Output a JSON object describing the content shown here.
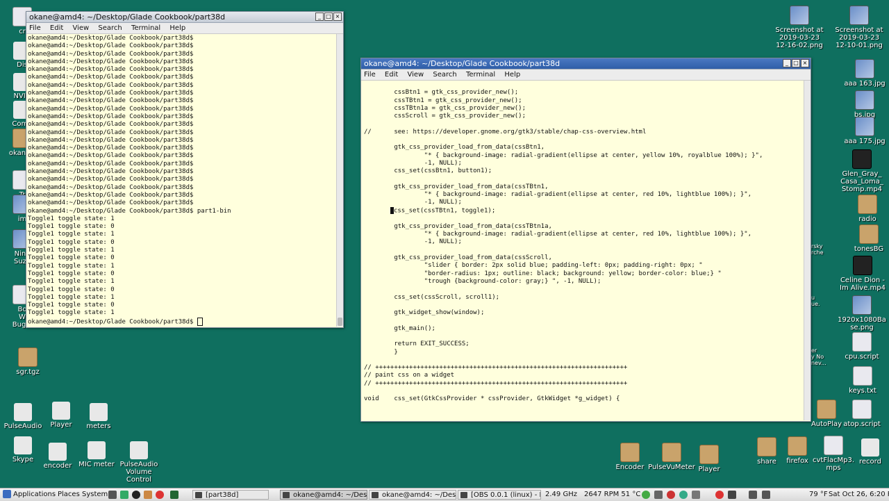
{
  "desktop_left": [
    {
      "id": "cr",
      "label": "cr"
    },
    {
      "id": "dis",
      "label": "Dis"
    },
    {
      "id": "nvid",
      "label": "NVID"
    },
    {
      "id": "comp",
      "label": "Comp"
    },
    {
      "id": "okanes",
      "label": "okane's"
    },
    {
      "id": "tr",
      "label": "Tr"
    },
    {
      "id": "im",
      "label": "im"
    },
    {
      "id": "nina",
      "label": "Nina\nSuza"
    },
    {
      "id": "bo",
      "label": "Bo\nW\nBugle"
    },
    {
      "id": "sgr",
      "label": "sgr.tgz"
    },
    {
      "id": "pulseaudio",
      "label": "PulseAudio"
    },
    {
      "id": "player",
      "label": "Player"
    },
    {
      "id": "meters",
      "label": "meters"
    },
    {
      "id": "skype",
      "label": "Skype"
    },
    {
      "id": "encoder",
      "label": "encoder"
    },
    {
      "id": "micmeter",
      "label": "MIC meter"
    },
    {
      "id": "pavc",
      "label": "PulseAudio\nVolume\nControl"
    }
  ],
  "desktop_right": [
    {
      "id": "ss1",
      "label": "Screenshot at\n2019-03-23\n12-16-02.png"
    },
    {
      "id": "ss2",
      "label": "Screenshot at\n2019-03-23\n12-10-01.png"
    },
    {
      "id": "aaa163",
      "label": "aaa 163.jpg"
    },
    {
      "id": "bs",
      "label": "bs.jpg"
    },
    {
      "id": "aaa175",
      "label": "aaa 175.jpg"
    },
    {
      "id": "glen",
      "label": "Glen_Gray_\nCasa_Loma_\nStomp.mp4"
    },
    {
      "id": "radio",
      "label": "radio"
    },
    {
      "id": "tonesbg",
      "label": "tonesBG"
    },
    {
      "id": "celine",
      "label": "Celine Dion -\nIm Alive.mp4"
    },
    {
      "id": "png1920",
      "label": "1920x1080Ba\nse.png"
    },
    {
      "id": "cpuscript",
      "label": "cpu.script"
    },
    {
      "id": "keys",
      "label": "keys.txt"
    },
    {
      "id": "autoplay",
      "label": "AutoPlay"
    },
    {
      "id": "atop",
      "label": "atop.script"
    },
    {
      "id": "encoder2",
      "label": "Encoder"
    },
    {
      "id": "pvm",
      "label": "PulseVuMeter"
    },
    {
      "id": "player2",
      "label": "Player"
    },
    {
      "id": "share",
      "label": "share"
    },
    {
      "id": "firefox",
      "label": "firefox"
    },
    {
      "id": "cvt",
      "label": "cvtFlacMp3.\nmps"
    },
    {
      "id": "record",
      "label": "record"
    }
  ],
  "snippets": [
    "rsky\nrche",
    "u\nue.",
    "er\ny No\nnev..."
  ],
  "left_window": {
    "title": "okane@amd4: ~/Desktop/Glade Cookbook/part38d",
    "menu": [
      "File",
      "Edit",
      "View",
      "Search",
      "Terminal",
      "Help"
    ],
    "lines": [
      "okane@amd4:~/Desktop/Glade Cookbook/part38d$",
      "okane@amd4:~/Desktop/Glade Cookbook/part38d$",
      "okane@amd4:~/Desktop/Glade Cookbook/part38d$",
      "okane@amd4:~/Desktop/Glade Cookbook/part38d$",
      "okane@amd4:~/Desktop/Glade Cookbook/part38d$",
      "okane@amd4:~/Desktop/Glade Cookbook/part38d$",
      "okane@amd4:~/Desktop/Glade Cookbook/part38d$",
      "okane@amd4:~/Desktop/Glade Cookbook/part38d$",
      "okane@amd4:~/Desktop/Glade Cookbook/part38d$",
      "okane@amd4:~/Desktop/Glade Cookbook/part38d$",
      "okane@amd4:~/Desktop/Glade Cookbook/part38d$",
      "okane@amd4:~/Desktop/Glade Cookbook/part38d$",
      "okane@amd4:~/Desktop/Glade Cookbook/part38d$",
      "okane@amd4:~/Desktop/Glade Cookbook/part38d$",
      "okane@amd4:~/Desktop/Glade Cookbook/part38d$",
      "okane@amd4:~/Desktop/Glade Cookbook/part38d$",
      "okane@amd4:~/Desktop/Glade Cookbook/part38d$",
      "okane@amd4:~/Desktop/Glade Cookbook/part38d$",
      "okane@amd4:~/Desktop/Glade Cookbook/part38d$",
      "okane@amd4:~/Desktop/Glade Cookbook/part38d$",
      "okane@amd4:~/Desktop/Glade Cookbook/part38d$",
      "okane@amd4:~/Desktop/Glade Cookbook/part38d$",
      "okane@amd4:~/Desktop/Glade Cookbook/part38d$ part1-bin",
      "Toggle1 toggle state: 1",
      "Toggle1 toggle state: 0",
      "Toggle1 toggle state: 1",
      "Toggle1 toggle state: 0",
      "Toggle1 toggle state: 1",
      "Toggle1 toggle state: 0",
      "Toggle1 toggle state: 1",
      "Toggle1 toggle state: 0",
      "Toggle1 toggle state: 1",
      "Toggle1 toggle state: 0",
      "Toggle1 toggle state: 1",
      "Toggle1 toggle state: 0",
      "Toggle1 toggle state: 1"
    ],
    "prompt": "okane@amd4:~/Desktop/Glade Cookbook/part38d$ "
  },
  "right_window": {
    "title": "okane@amd4: ~/Desktop/Glade Cookbook/part38d",
    "menu": [
      "File",
      "Edit",
      "View",
      "Search",
      "Terminal",
      "Help"
    ],
    "lines": [
      "",
      "        cssBtn1 = gtk_css_provider_new();",
      "        cssTBtn1 = gtk_css_provider_new();",
      "        cssTBtn1a = gtk_css_provider_new();",
      "        cssScroll = gtk_css_provider_new();",
      "",
      "//      see: https://developer.gnome.org/gtk3/stable/chap-css-overview.html",
      "",
      "        gtk_css_provider_load_from_data(cssBtn1,",
      "                \"* { background-image: radial-gradient(ellipse at center, yellow 10%, royalblue 100%); }\",",
      "                -1, NULL);",
      "        css_set(cssBtn1, button1);",
      "",
      "        gtk_css_provider_load_from_data(cssTBtn1,",
      "                \"* { background-image: radial-gradient(ellipse at center, red 10%, lightblue 100%); }\",",
      "                -1, NULL);",
      "        css_set(cssTBtn1, toggle1);",
      "",
      "        gtk_css_provider_load_from_data(cssTBtn1a,",
      "                \"* { background-image: radial-gradient(ellipse at center, red 10%, lightblue 100%); }\",",
      "                -1, NULL);",
      "",
      "        gtk_css_provider_load_from_data(cssScroll,",
      "                \"slider { border: 2px solid blue; padding-left: 0px; padding-right: 0px; \"",
      "                \"border-radius: 1px; outline: black; background: yellow; border-color: blue;} \"",
      "                \"trough {background-color: gray;} \", -1, NULL);",
      "",
      "        css_set(cssScroll, scroll1);",
      "",
      "        gtk_widget_show(window);",
      "",
      "        gtk_main();",
      "",
      "        return EXIT_SUCCESS;",
      "        }",
      "",
      "// +++++++++++++++++++++++++++++++++++++++++++++++++++++++++++++++++++",
      "// paint css on a widget",
      "// +++++++++++++++++++++++++++++++++++++++++++++++++++++++++++++++++++",
      "",
      "void    css_set(GtkCssProvider * cssProvider, GtkWidget *g_widget) {"
    ]
  },
  "panel": {
    "applications": "Applications",
    "places": "Places",
    "system": "System",
    "tasks": [
      {
        "label": "[part38d]",
        "active": false
      },
      {
        "label": "okane@amd4: ~/Desk...",
        "active": true
      },
      {
        "label": "okane@amd4: ~/Desk...",
        "active": false
      },
      {
        "label": "[OBS 0.0.1 (linux) - Pro...",
        "active": false
      }
    ],
    "cpu": "2.49 GHz",
    "fan": "2647 RPM 51 °C",
    "temp": "79 °F",
    "clock": "Sat Oct 26, 6:20 PM"
  }
}
